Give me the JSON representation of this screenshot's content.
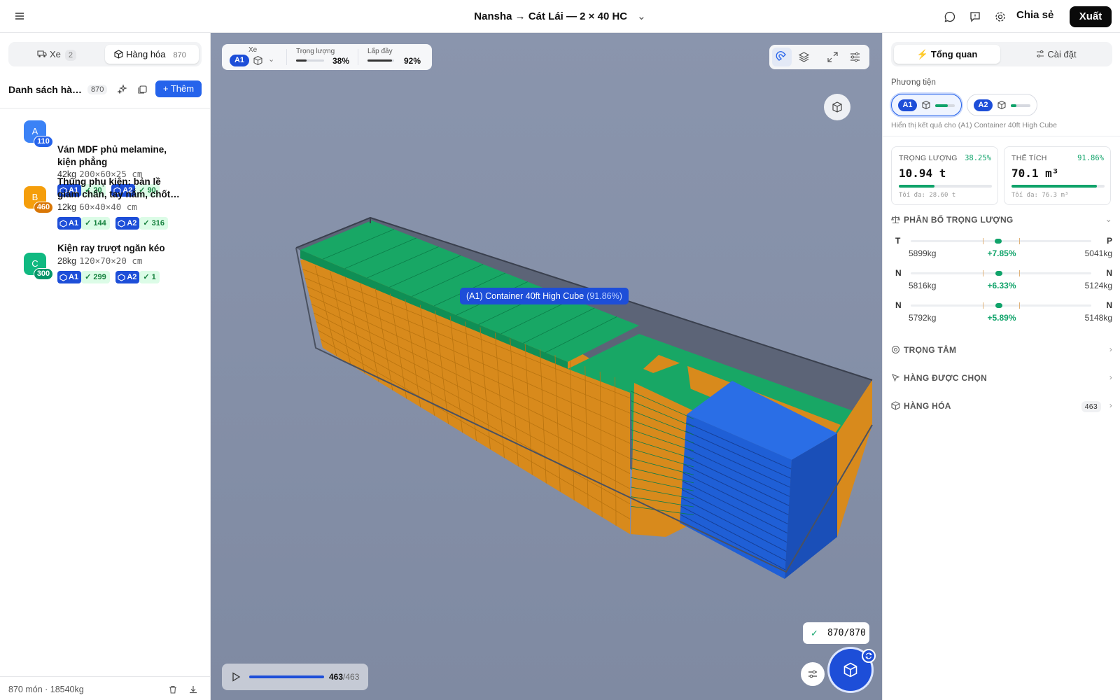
{
  "header": {
    "title": "Nansha → Cát Lái — 2 × 40 HC",
    "share_label": "Chia sẻ",
    "export_label": "Xuất"
  },
  "left": {
    "tabs": [
      {
        "label": "Xe",
        "count": "2"
      },
      {
        "label": "Hàng hóa",
        "count": "870"
      }
    ],
    "list_title": "Danh sách hàng hóa",
    "list_count": "870",
    "add_label": "+ Thêm",
    "items": [
      {
        "letter": "A",
        "badge": "110",
        "color": "#3b82f6",
        "name_line1": "Ván MDF phủ melamine,",
        "name_line2": "kiện phẳng",
        "weight": "42kg",
        "dims": "200×60×25 cm",
        "a1": "20",
        "a2": "90"
      },
      {
        "letter": "B",
        "badge": "460",
        "color": "#f59e0b",
        "name_line1": "Thùng phụ kiện: bản lề",
        "name_line2": "giảm chấn, tay nắm, chốt…",
        "weight": "12kg",
        "dims": "60×40×40 cm",
        "a1": "144",
        "a2": "316"
      },
      {
        "letter": "C",
        "badge": "300",
        "color": "#10b981",
        "name_line1": "Kiện ray trượt ngăn kéo",
        "name_line2": "",
        "weight": "28kg",
        "dims": "120×70×20 cm",
        "a1": "299",
        "a2": "1"
      }
    ],
    "vehicle_tags": [
      "A1",
      "A2"
    ],
    "footer": "870 món · 18540kg"
  },
  "viewport": {
    "vehicle_label": "Xe",
    "vehicle_selected": "A1",
    "weight_label": "Trọng lượng",
    "weight_pct": "38%",
    "weight_fraction": 0.38,
    "fill_label": "Lấp đầy",
    "fill_pct": "92%",
    "fill_fraction": 0.92,
    "container_label": "(A1) Container 40ft High Cube",
    "container_pct": "(91.86%)",
    "done": "870/870",
    "progress_done": "463",
    "progress_total": "/463",
    "progress_fraction": 1.0,
    "colors": {
      "green": "#10a36a",
      "orange": "#d88a1c",
      "blue": "#1f5fd6"
    }
  },
  "right": {
    "tabs": [
      "Tổng quan",
      "Cài đặt"
    ],
    "vehicles_label": "Phương tiện",
    "vehicles": [
      {
        "id": "A1",
        "fill": 0.65
      },
      {
        "id": "A2",
        "fill": 0.3
      }
    ],
    "hint": "Hiển thị kết quả cho (A1) Container 40ft High Cube",
    "weight_card": {
      "label": "TRỌNG LƯỢNG",
      "pct": "38.25%",
      "value": "10.94 t",
      "fraction": 0.3825,
      "max": "Tối đa: 28.60 t"
    },
    "volume_card": {
      "label": "THỂ TÍCH",
      "pct": "91.86%",
      "value": "70.1 m³",
      "fraction": 0.9186,
      "max": "Tối đa: 76.3 m³"
    },
    "distribution_title": "PHÂN BỐ TRỌNG LƯỢNG",
    "rows": [
      {
        "left": "T",
        "right": "P",
        "kl": "5899kg",
        "pct": "+7.85%",
        "kr": "5041kg"
      },
      {
        "left": "N",
        "right": "N",
        "kl": "5816kg",
        "pct": "+6.33%",
        "kr": "5124kg"
      },
      {
        "left": "N",
        "right": "N",
        "kl": "5792kg",
        "pct": "+5.89%",
        "kr": "5148kg"
      }
    ],
    "center_title": "TRỌNG TÂM",
    "selected_title": "HÀNG ĐƯỢC CHỌN",
    "cargo_title": "HÀNG HÓA",
    "cargo_count": "463"
  }
}
